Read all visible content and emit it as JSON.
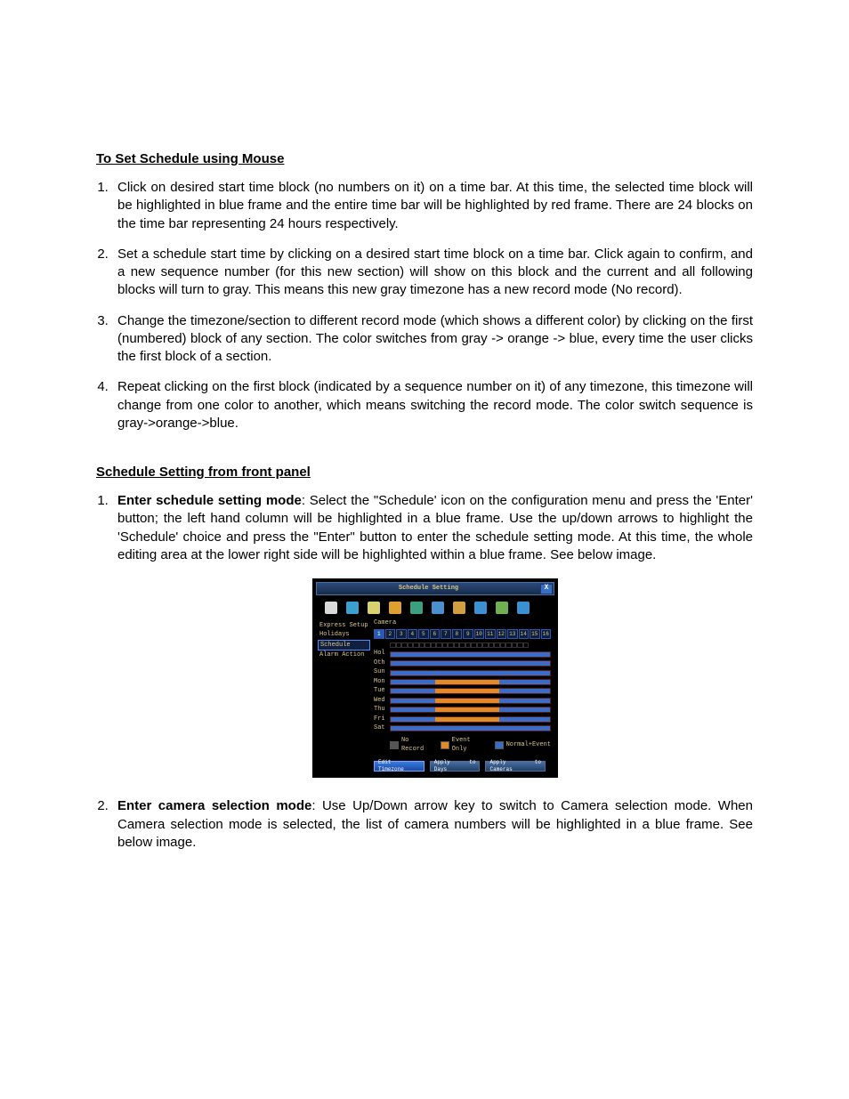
{
  "h1": "To Set Schedule using Mouse",
  "steps1": [
    "Click on desired start time block (no numbers on it) on a time bar. At this time, the selected time block will be highlighted in blue frame and the entire time bar will be highlighted by red frame. There are 24 blocks on the time bar representing 24 hours respectively.",
    "Set a schedule start time by clicking on a desired start time block on a time bar.  Click again to confirm, and a new sequence number (for this new section) will show on this block and the current and all following blocks will turn to gray. This means this new gray timezone has a new record mode (No record).",
    "Change the timezone/section to different record mode (which shows a different color) by clicking on the first (numbered) block of any section. The color switches from gray -> orange -> blue, every time the user clicks the first block of a section.",
    "Repeat clicking on the first block (indicated by a sequence number on it) of any timezone, this timezone will change from one color to another, which means switching the record mode. The color switch sequence is gray->orange->blue."
  ],
  "h2": "Schedule Setting from front panel",
  "steps2": [
    {
      "bold": "Enter schedule setting mode",
      "rest": ": Select the \"Schedule' icon on the configuration menu and press the 'Enter' button; the left hand column will be highlighted in a blue frame. Use the up/down arrows to highlight the 'Schedule' choice and press the \"Enter\" button to enter the schedule setting mode. At this time, the whole editing area at the lower right side will be highlighted within a blue frame. See below image."
    },
    {
      "bold": "Enter camera selection mode",
      "rest": ": Use Up/Down arrow key to switch to Camera selection mode. When Camera selection mode is selected, the list of camera numbers will be highlighted in a blue frame. See below image."
    }
  ],
  "fig": {
    "title": "Schedule Setting",
    "close": "X",
    "toolbar_colors": [
      "#d9d9d9",
      "#3aa0d0",
      "#d9d070",
      "#e0a030",
      "#3aa080",
      "#4a90d0",
      "#d0a040",
      "#3a90d0",
      "#70b050",
      "#3a90d0"
    ],
    "sidebar": {
      "items": [
        "Express Setup",
        "Holidays",
        "Schedule",
        "Alarm Action"
      ],
      "selected_index": 2
    },
    "camera_label": "Camera",
    "cameras": [
      "1",
      "2",
      "3",
      "4",
      "5",
      "6",
      "7",
      "8",
      "9",
      "10",
      "11",
      "12",
      "13",
      "14",
      "15",
      "16"
    ],
    "camera_selected": 0,
    "days": [
      "Hol",
      "Oth",
      "Sun",
      "Mon",
      "Tue",
      "Wed",
      "Thu",
      "Fri",
      "Sat"
    ],
    "day_patterns": {
      "Hol": [
        [
          "blue",
          100
        ]
      ],
      "Oth": [
        [
          "blue",
          100
        ]
      ],
      "Sun": [
        [
          "blue",
          100
        ]
      ],
      "Mon": [
        [
          "blue",
          28
        ],
        [
          "orange",
          40
        ],
        [
          "blue",
          32
        ]
      ],
      "Tue": [
        [
          "blue",
          28
        ],
        [
          "orange",
          40
        ],
        [
          "blue",
          32
        ]
      ],
      "Wed": [
        [
          "blue",
          28
        ],
        [
          "orange",
          40
        ],
        [
          "blue",
          32
        ]
      ],
      "Thu": [
        [
          "blue",
          28
        ],
        [
          "orange",
          40
        ],
        [
          "blue",
          32
        ]
      ],
      "Fri": [
        [
          "blue",
          28
        ],
        [
          "orange",
          40
        ],
        [
          "blue",
          32
        ]
      ],
      "Sat": [
        [
          "blue",
          100
        ]
      ]
    },
    "legend": [
      {
        "swatch": "g",
        "label": "No Record"
      },
      {
        "swatch": "o",
        "label": "Event Only"
      },
      {
        "swatch": "b",
        "label": "Normal+Event"
      }
    ],
    "buttons": [
      {
        "label": "Edit Timezone",
        "selected": true
      },
      {
        "label": "Apply to Days",
        "selected": false
      },
      {
        "label": "Apply to Cameras",
        "selected": false
      }
    ]
  }
}
